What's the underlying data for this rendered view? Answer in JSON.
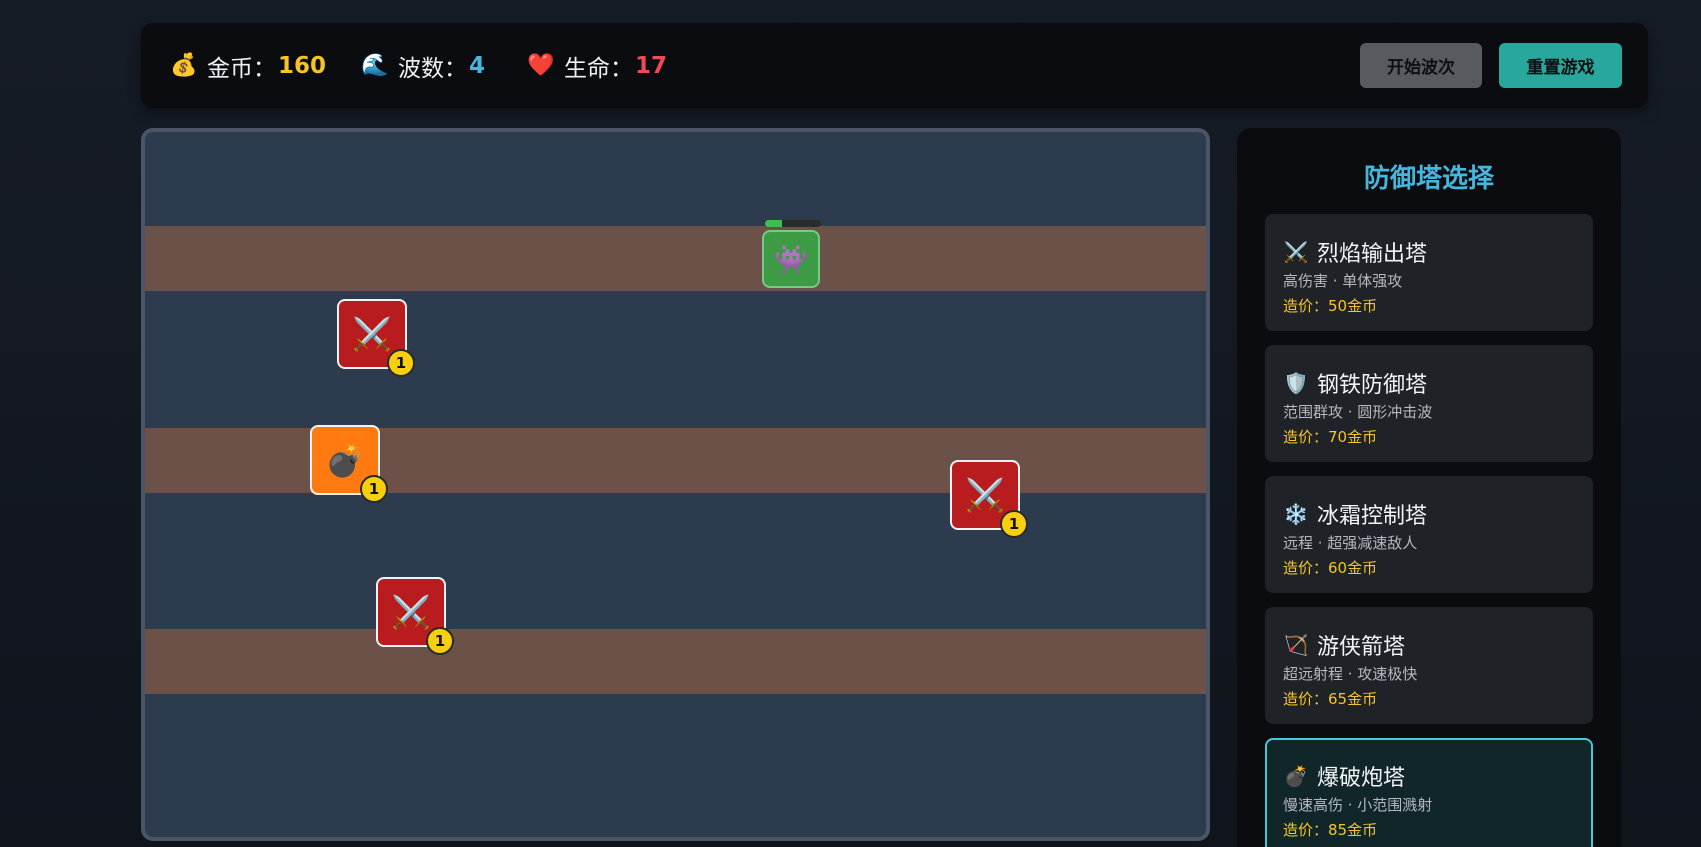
{
  "hud": {
    "gold_icon": "💰",
    "gold_label": "金币：",
    "gold_value": "160",
    "wave_icon": "🌊",
    "wave_label": "波数：",
    "wave_value": "4",
    "life_icon": "❤️",
    "life_label": "生命：",
    "life_value": "17"
  },
  "buttons": {
    "start": "开始波次",
    "reset": "重置游戏"
  },
  "board": {
    "towers": [
      {
        "icon": "⚔️",
        "level": "1",
        "type": "sword"
      },
      {
        "icon": "💣",
        "level": "1",
        "type": "bomb"
      },
      {
        "icon": "⚔️",
        "level": "1",
        "type": "sword"
      },
      {
        "icon": "⚔️",
        "level": "1",
        "type": "sword"
      }
    ],
    "enemy": {
      "icon": "👾",
      "hp_fraction": 0.3
    }
  },
  "panel": {
    "title": "防御塔选择",
    "cards": [
      {
        "icon": "⚔️",
        "name": "烈焰输出塔",
        "desc": "高伤害 · 单体强攻",
        "cost": "造价：50金币"
      },
      {
        "icon": "🛡️",
        "name": "钢铁防御塔",
        "desc": "范围群攻 · 圆形冲击波",
        "cost": "造价：70金币"
      },
      {
        "icon": "❄️",
        "name": "冰霜控制塔",
        "desc": "远程 · 超强减速敌人",
        "cost": "造价：60金币"
      },
      {
        "icon": "🏹",
        "name": "游侠箭塔",
        "desc": "超远射程 · 攻速极快",
        "cost": "造价：65金币"
      },
      {
        "icon": "💣",
        "name": "爆破炮塔",
        "desc": "慢速高伤 · 小范围溅射",
        "cost": "造价：85金币",
        "selected": true
      }
    ]
  },
  "colors": {
    "gold": "#f7c325",
    "wave": "#47b6dc",
    "life": "#ef4a55",
    "accent": "#28a89c",
    "lane": "#6b5148",
    "board": "#2c3b4d"
  }
}
